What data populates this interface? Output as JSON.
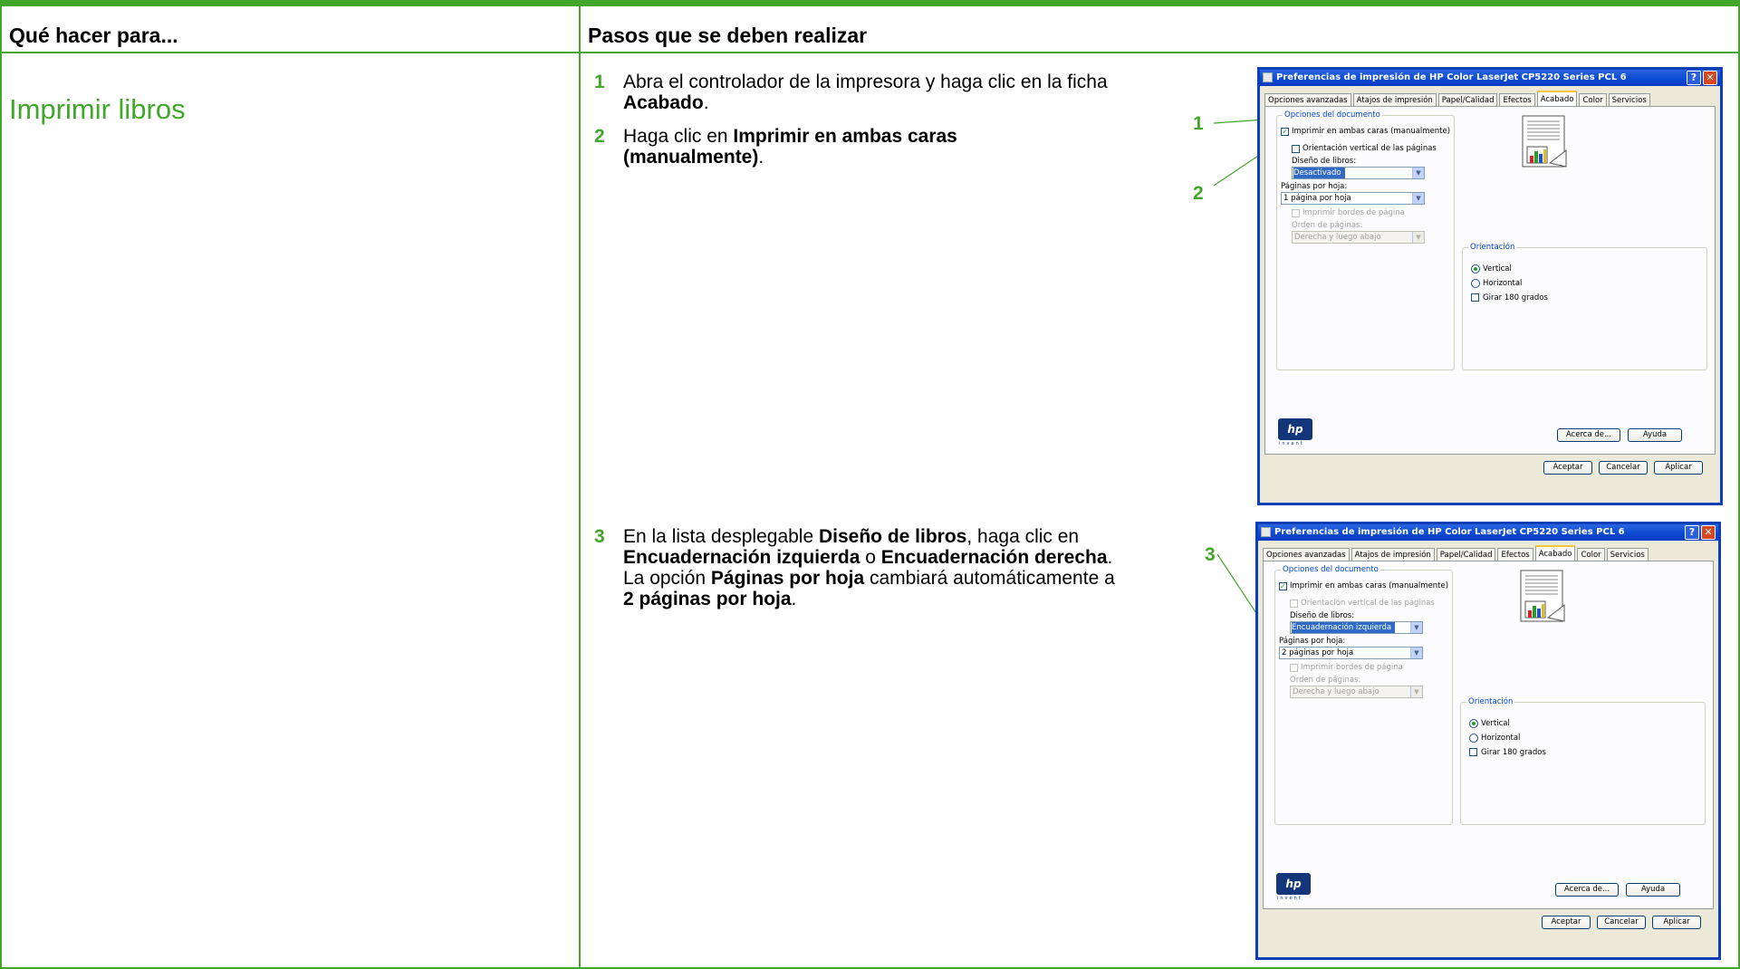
{
  "table": {
    "col1_header": "Qué hacer para...",
    "col2_header": "Pasos que se deben realizar",
    "section_title": "Imprimir libros",
    "accent_color": "#41a62a"
  },
  "steps": [
    {
      "num": "1",
      "parts": [
        "Abra el controlador de la impresora y haga clic en la ficha ",
        "Acabado",
        "."
      ]
    },
    {
      "num": "2",
      "parts": [
        "Haga clic en ",
        "Imprimir en ambas caras (manualmente)",
        "."
      ]
    },
    {
      "num": "3",
      "parts": [
        "En la lista desplegable ",
        "Diseño de libros",
        ", haga clic en ",
        "Encuadernación izquierda",
        " o ",
        "Encuadernación derecha",
        ". La opción ",
        "Páginas por hoja",
        " cambiará automáticamente a ",
        "2 páginas por hoja",
        "."
      ]
    }
  ],
  "callouts": [
    "1",
    "2",
    "3"
  ],
  "dialogs": [
    {
      "title": "Preferencias de impresión de HP Color LaserJet CP5220 Series PCL 6",
      "help_glyph": "?",
      "close_glyph": "✕",
      "tabs": [
        "Opciones avanzadas",
        "Atajos de impresión",
        "Papel/Calidad",
        "Efectos",
        "Acabado",
        "Color",
        "Servicios"
      ],
      "active_tab": "Acabado",
      "doc_options_label": "Opciones del documento",
      "duplex_label": "Imprimir en ambas caras (manualmente)",
      "duplex_checked": true,
      "flip_label": "Orientación vertical de las páginas",
      "flip_enabled": true,
      "booklet_label": "Diseño de libros:",
      "booklet_value": "Desactivado",
      "pages_label": "Páginas por hoja:",
      "pages_value": "1 página por hoja",
      "borders_label": "Imprimir bordes de página",
      "order_label": "Orden de páginas:",
      "order_value": "Derecha y luego abajo",
      "orientation_label": "Orientación",
      "portrait_label": "Vertical",
      "landscape_label": "Horizontal",
      "rotate_label": "Girar 180 grados",
      "about_button": "Acerca de...",
      "help_button": "Ayuda",
      "ok_button": "Aceptar",
      "cancel_button": "Cancelar",
      "apply_button": "Aplicar",
      "logo_text": "hp",
      "logo_tagline": "invent"
    },
    {
      "title": "Preferencias de impresión de HP Color LaserJet CP5220 Series PCL 6",
      "help_glyph": "?",
      "close_glyph": "✕",
      "tabs": [
        "Opciones avanzadas",
        "Atajos de impresión",
        "Papel/Calidad",
        "Efectos",
        "Acabado",
        "Color",
        "Servicios"
      ],
      "active_tab": "Acabado",
      "doc_options_label": "Opciones del documento",
      "duplex_label": "Imprimir en ambas caras (manualmente)",
      "duplex_checked": true,
      "flip_label": "Orientación vertical de las páginas",
      "flip_enabled": false,
      "booklet_label": "Diseño de libros:",
      "booklet_value": "Encuadernación izquierda",
      "pages_label": "Páginas por hoja:",
      "pages_value": "2 páginas por hoja",
      "borders_label": "Imprimir bordes de página",
      "order_label": "Orden de páginas:",
      "order_value": "Derecha y luego abajo",
      "orientation_label": "Orientación",
      "portrait_label": "Vertical",
      "landscape_label": "Horizontal",
      "rotate_label": "Girar 180 grados",
      "about_button": "Acerca de...",
      "help_button": "Ayuda",
      "ok_button": "Aceptar",
      "cancel_button": "Cancelar",
      "apply_button": "Aplicar",
      "logo_text": "hp",
      "logo_tagline": "invent"
    }
  ]
}
